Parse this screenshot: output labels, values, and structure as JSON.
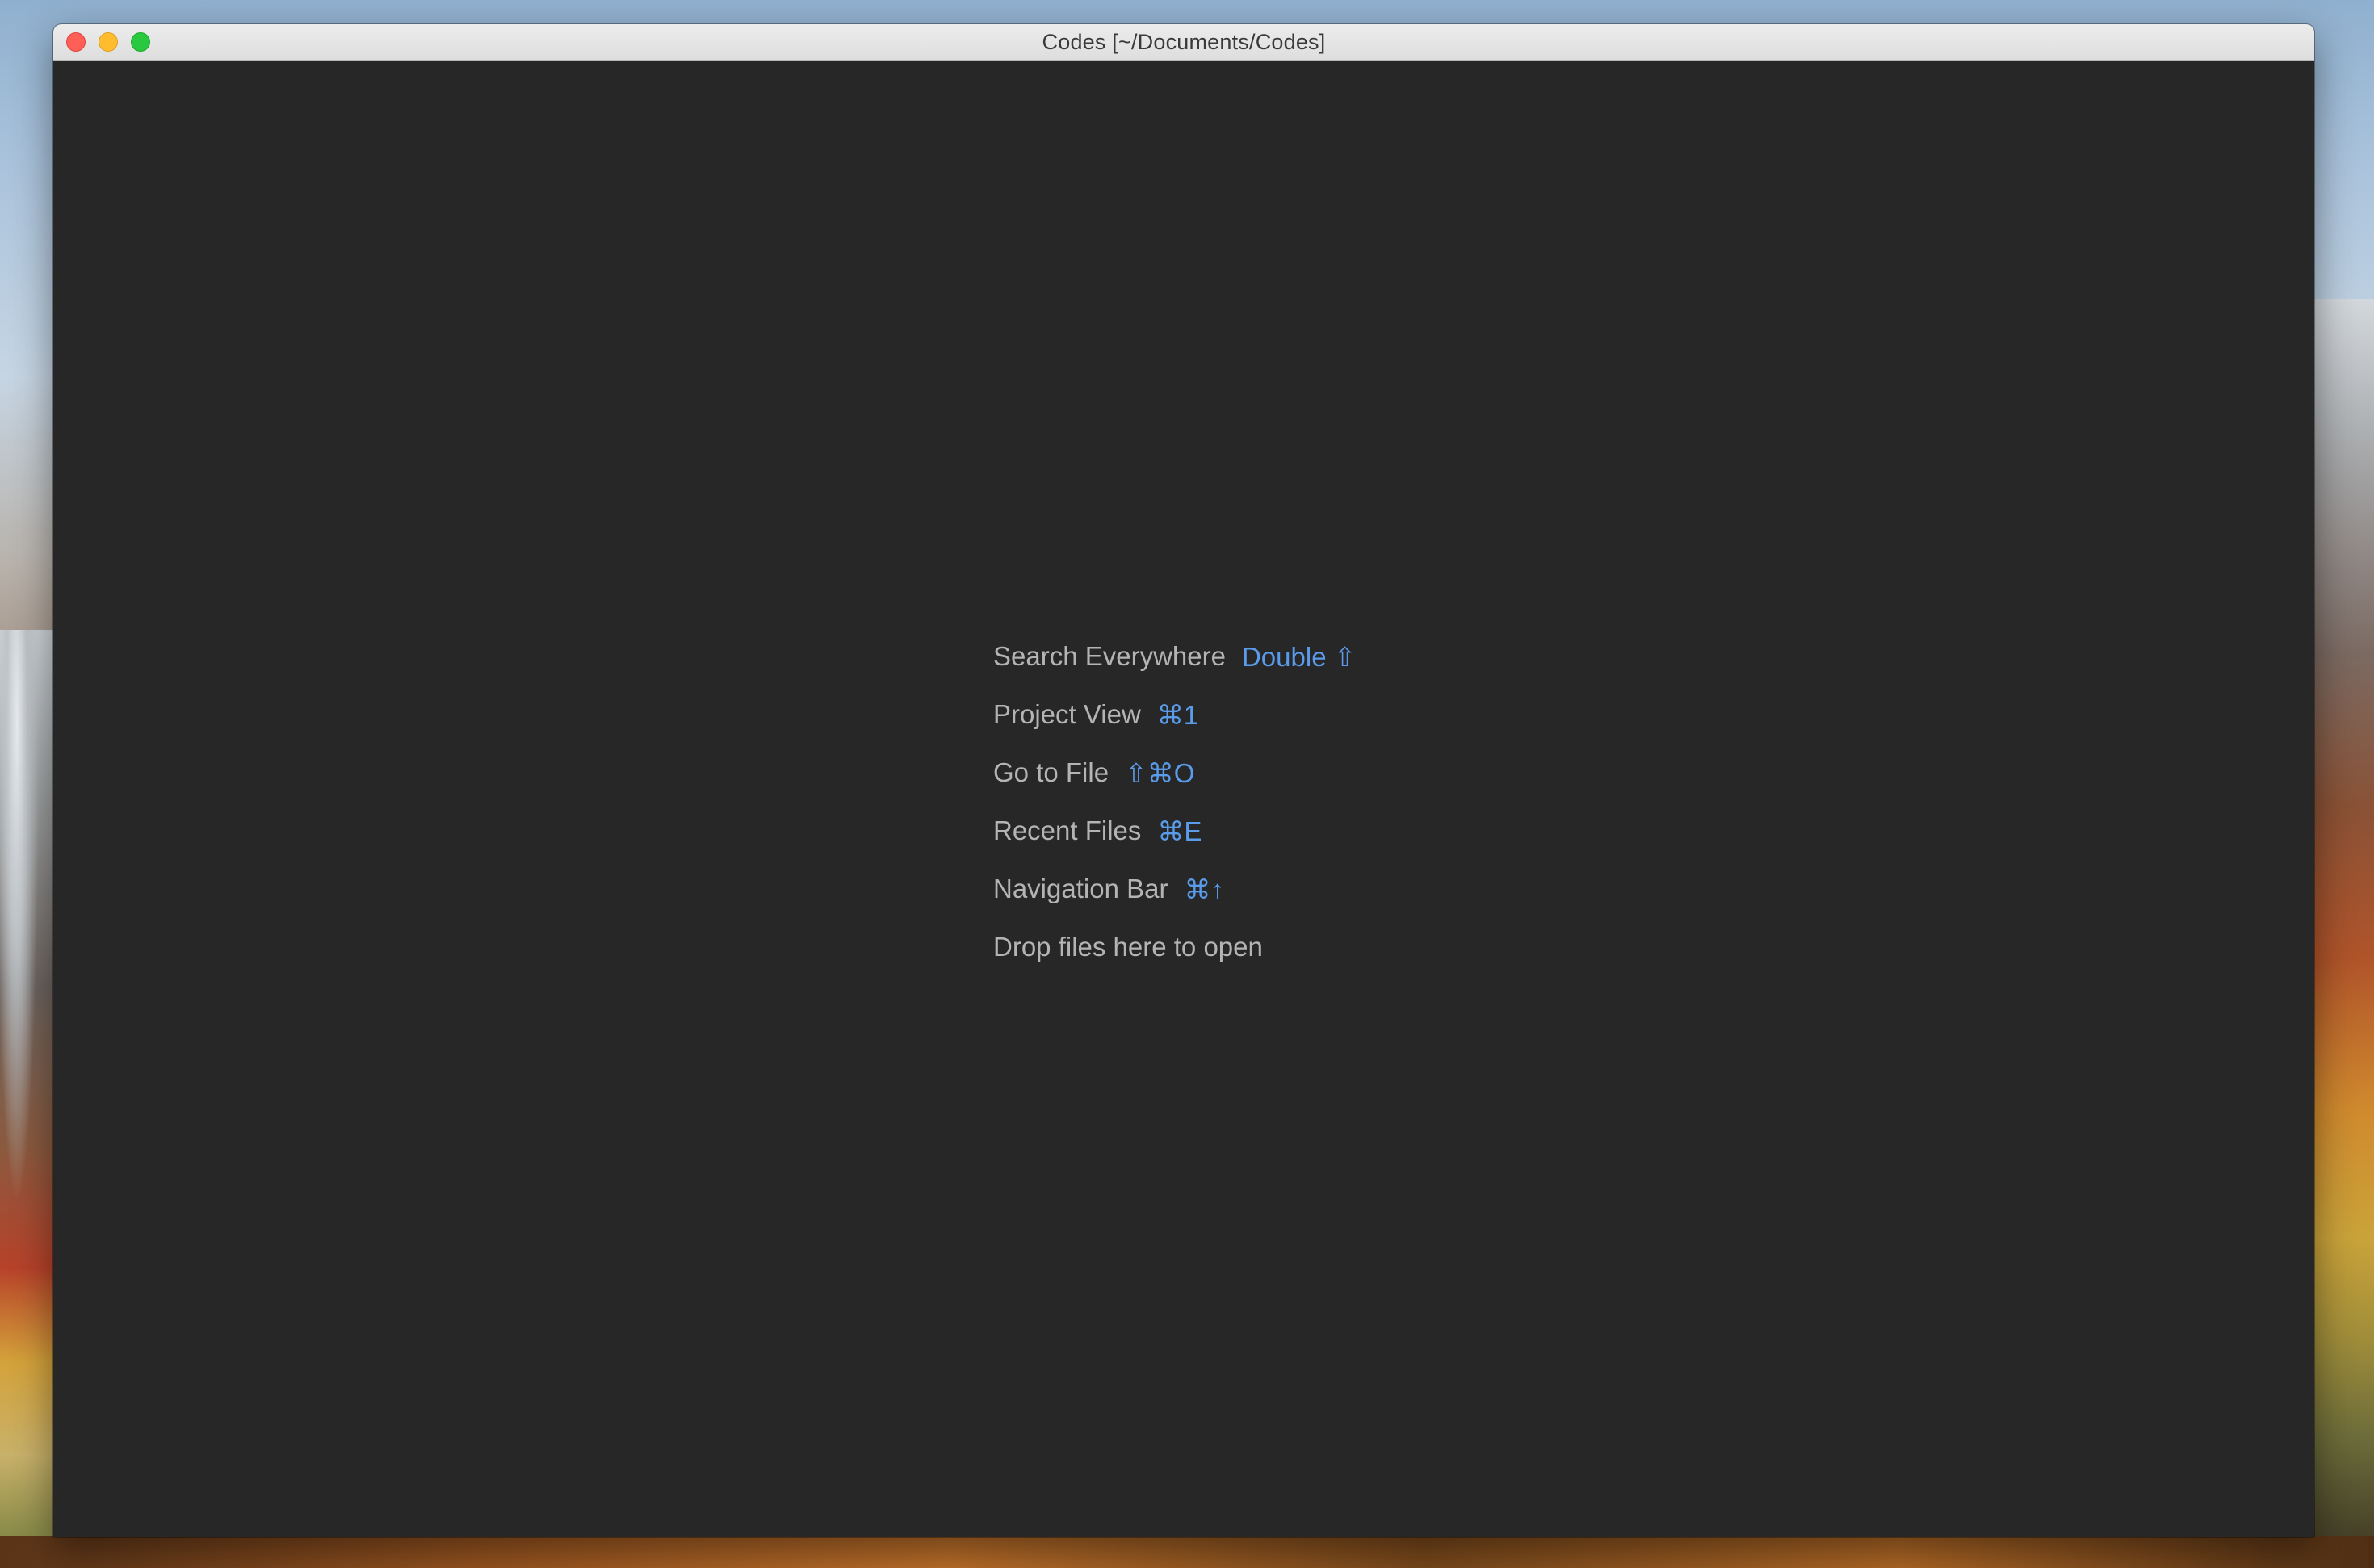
{
  "window": {
    "title": "Codes [~/Documents/Codes]"
  },
  "hints": [
    {
      "label": "Search Everywhere",
      "shortcut": "Double ⇧"
    },
    {
      "label": "Project View",
      "shortcut": "⌘1"
    },
    {
      "label": "Go to File",
      "shortcut": "⇧⌘O"
    },
    {
      "label": "Recent Files",
      "shortcut": "⌘E"
    },
    {
      "label": "Navigation Bar",
      "shortcut": "⌘↑"
    },
    {
      "label": "Drop files here to open",
      "shortcut": ""
    }
  ],
  "colors": {
    "editor_background": "#272727",
    "hint_text": "#b4b4b4",
    "shortcut_text": "#5a9bea"
  }
}
